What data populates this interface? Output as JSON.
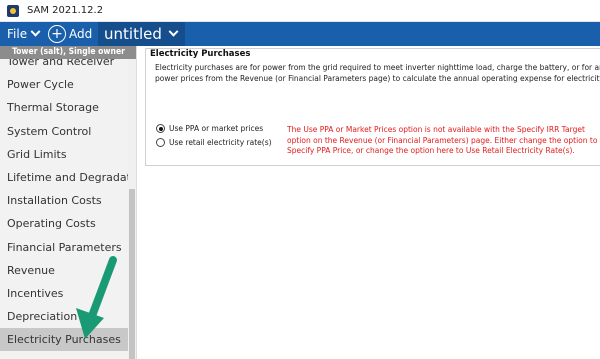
{
  "window": {
    "title": "SAM 2021.12.2"
  },
  "toolbar": {
    "file_label": "File",
    "add_label": "Add",
    "case_tab_label": "untitled"
  },
  "sidebar": {
    "config_name": "Tower (salt), Single owner",
    "items": [
      {
        "label": "Tower and Receiver",
        "selected": false
      },
      {
        "label": "Power Cycle",
        "selected": false
      },
      {
        "label": "Thermal Storage",
        "selected": false
      },
      {
        "label": "System Control",
        "selected": false
      },
      {
        "label": "Grid Limits",
        "selected": false
      },
      {
        "label": "Lifetime and Degradation",
        "selected": false
      },
      {
        "label": "Installation Costs",
        "selected": false
      },
      {
        "label": "Operating Costs",
        "selected": false
      },
      {
        "label": "Financial Parameters",
        "selected": false
      },
      {
        "label": "Revenue",
        "selected": false
      },
      {
        "label": "Incentives",
        "selected": false
      },
      {
        "label": "Depreciation",
        "selected": false
      },
      {
        "label": "Electricity Purchases",
        "selected": true
      }
    ]
  },
  "panel": {
    "title": "Electricity Purchases",
    "description_line1": "Electricity purchases are for power from the grid required to meet inverter nighttime load, charge the battery, or for any other power",
    "description_line2": "power prices from the Revenue (or Financial Parameters page) to calculate the annual operating expense for electricity purchases. T",
    "option_ppa_label": "Use PPA or market prices",
    "option_ppa_checked": true,
    "option_retail_label": "Use retail electricity rate(s)",
    "option_retail_checked": false,
    "warning_text": "The Use PPA or Market Prices option is not available with the Specify IRR Target option on the Revenue (or Financial Parameters) page. Either change the option to Specify PPA Price, or change the option here to Use Retail Electricity Rate(s)."
  },
  "colors": {
    "toolbar_blue": "#1a5fab",
    "arrow_green": "#1a9a74",
    "warning_red": "#e31b1b",
    "selected_bg": "#c8c8c8"
  },
  "icons": {
    "app": "sam-app-icon",
    "add": "plus-circle-icon",
    "dropdown": "chevron-down-icon",
    "annotation": "arrow-annotation-icon"
  }
}
